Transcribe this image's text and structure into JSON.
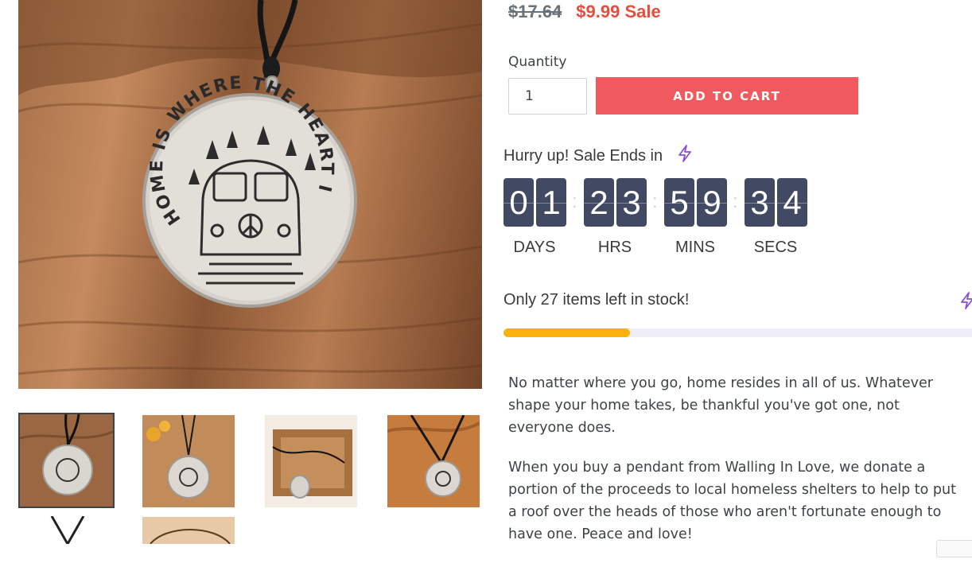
{
  "price": {
    "original": "$17.64",
    "sale": "$9.99",
    "sale_tag": "Sale"
  },
  "quantity": {
    "label": "Quantity",
    "value": "1"
  },
  "add_to_cart": "ADD TO CART",
  "timer": {
    "heading": "Hurry up! Sale Ends in",
    "days": [
      "0",
      "1"
    ],
    "hours": [
      "2",
      "3"
    ],
    "mins": [
      "5",
      "9"
    ],
    "secs": [
      "3",
      "4"
    ],
    "units": {
      "days": "DAYS",
      "hours": "HRS",
      "mins": "MINS",
      "secs": "SECS"
    }
  },
  "stock": {
    "text": "Only 27 items left in stock!",
    "level_percent": 27
  },
  "description": [
    "No matter where you go, home resides in all of us. Whatever shape your home takes, be thankful you've got one, not everyone does.",
    "When you buy a pendant from Walling In Love, we donate a portion of the proceeds to local homeless shelters to help to put a roof over the heads of those who aren't fortunate enough to have one. Peace and love!"
  ],
  "pendant_text": "HOME IS WHERE THE HEART IS",
  "icons": {
    "timer": "lightning-bolt-icon",
    "stock": "lightning-bolt-icon"
  },
  "colors": {
    "sale": "#e74c3c",
    "button": "#f05a5e",
    "timer_digit": "#414963",
    "stock_fill": "#f9b10b",
    "bolt": "#8a4fd8"
  }
}
